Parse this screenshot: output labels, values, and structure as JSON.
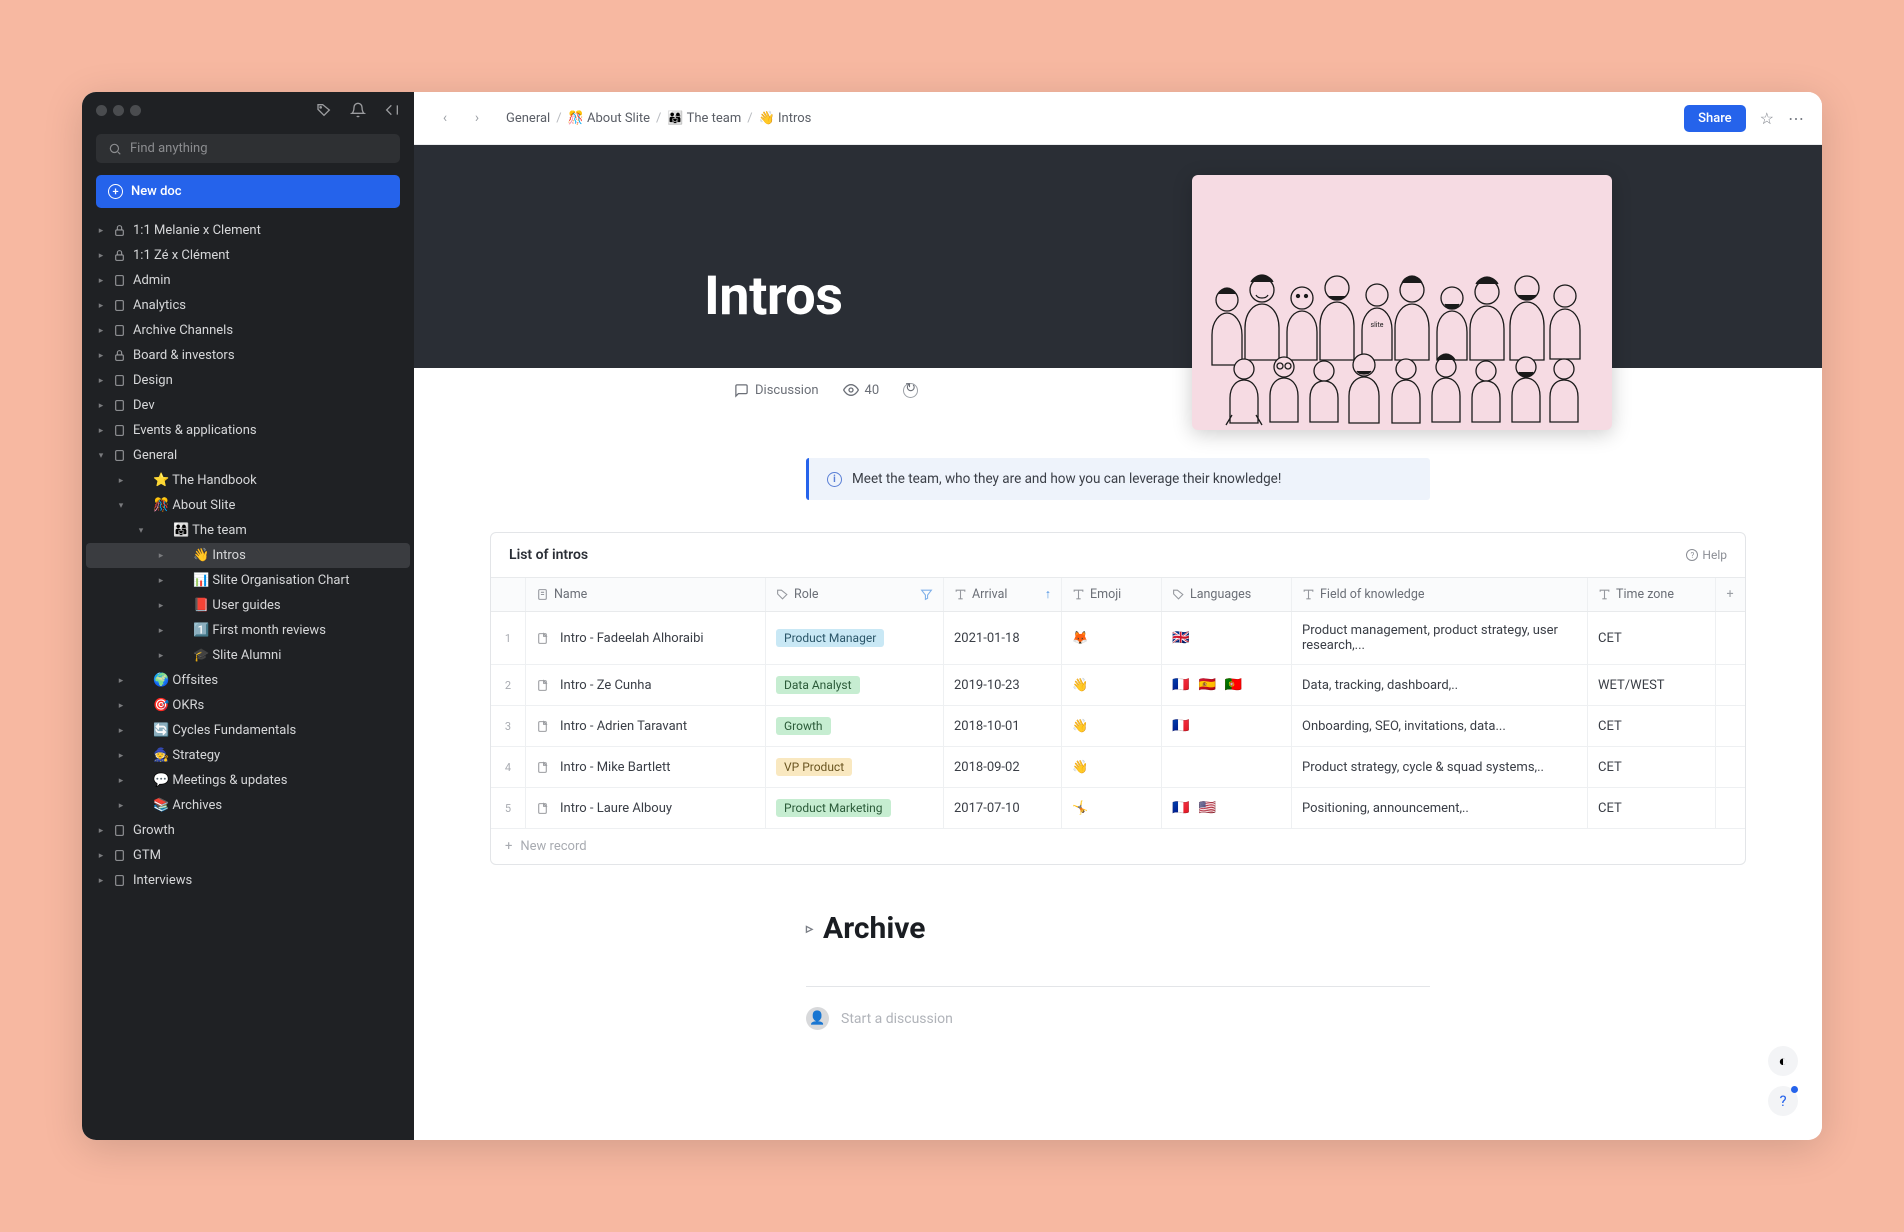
{
  "sidebar": {
    "search_placeholder": "Find anything",
    "new_doc": "New doc",
    "items": [
      {
        "label": "1:1 Melanie x Clement",
        "icon": "lock",
        "depth": 0,
        "tri": "▸"
      },
      {
        "label": "1:1 Zé x Clément",
        "icon": "lock",
        "depth": 0,
        "tri": "▸"
      },
      {
        "label": "Admin",
        "icon": "doc",
        "depth": 0,
        "tri": "▸"
      },
      {
        "label": "Analytics",
        "icon": "doc",
        "depth": 0,
        "tri": "▸"
      },
      {
        "label": "Archive Channels",
        "icon": "doc",
        "depth": 0,
        "tri": "▸"
      },
      {
        "label": "Board & investors",
        "icon": "lock",
        "depth": 0,
        "tri": "▸"
      },
      {
        "label": "Design",
        "icon": "doc",
        "depth": 0,
        "tri": "▸"
      },
      {
        "label": "Dev",
        "icon": "doc",
        "depth": 0,
        "tri": "▸"
      },
      {
        "label": "Events & applications",
        "icon": "doc",
        "depth": 0,
        "tri": "▸"
      },
      {
        "label": "General",
        "icon": "doc",
        "depth": 0,
        "tri": "▾"
      },
      {
        "label": "⭐ The Handbook",
        "icon": "",
        "depth": 1,
        "tri": "▸"
      },
      {
        "label": "🎊 About Slite",
        "icon": "",
        "depth": 1,
        "tri": "▾"
      },
      {
        "label": "👨‍👩‍👧 The team",
        "icon": "",
        "depth": 2,
        "tri": "▾"
      },
      {
        "label": "👋 Intros",
        "icon": "",
        "depth": 3,
        "tri": "▸",
        "active": true
      },
      {
        "label": "📊 Slite Organisation Chart",
        "icon": "",
        "depth": 3,
        "tri": "▸"
      },
      {
        "label": "📕 User guides",
        "icon": "",
        "depth": 3,
        "tri": "▸"
      },
      {
        "label": "1️⃣ First month reviews",
        "icon": "",
        "depth": 3,
        "tri": "▸"
      },
      {
        "label": "🎓 Slite Alumni",
        "icon": "",
        "depth": 3,
        "tri": "▸"
      },
      {
        "label": "🌍 Offsites",
        "icon": "",
        "depth": 1,
        "tri": "▸"
      },
      {
        "label": "🎯 OKRs",
        "icon": "",
        "depth": 1,
        "tri": "▸"
      },
      {
        "label": "🔄 Cycles Fundamentals",
        "icon": "",
        "depth": 1,
        "tri": "▸"
      },
      {
        "label": "🧙 Strategy",
        "icon": "",
        "depth": 1,
        "tri": "▸"
      },
      {
        "label": "💬 Meetings & updates",
        "icon": "",
        "depth": 1,
        "tri": "▸"
      },
      {
        "label": "📚 Archives",
        "icon": "",
        "depth": 1,
        "tri": "▸"
      },
      {
        "label": "Growth",
        "icon": "doc",
        "depth": 0,
        "tri": "▸"
      },
      {
        "label": "GTM",
        "icon": "doc",
        "depth": 0,
        "tri": "▸"
      },
      {
        "label": "Interviews",
        "icon": "doc",
        "depth": 0,
        "tri": "▸"
      }
    ]
  },
  "breadcrumb": [
    {
      "label": "General"
    },
    {
      "label": "🎊 About Slite"
    },
    {
      "label": "👨‍👩‍👧 The team"
    },
    {
      "label": "👋 Intros"
    }
  ],
  "share_label": "Share",
  "hero_title": "Intros",
  "discussion_label": "Discussion",
  "views_count": "40",
  "callout": "Meet the team, who they are and how you can leverage their knowledge!",
  "table": {
    "title": "List of intros",
    "help": "Help",
    "columns": [
      "Name",
      "Role",
      "Arrival",
      "Emoji",
      "Languages",
      "Field of knowledge",
      "Time zone"
    ],
    "rows": [
      {
        "idx": "1",
        "name": "Intro - Fadeelah Alhoraibi",
        "role": "Product Manager",
        "role_cls": "tag-pm",
        "arrival": "2021-01-18",
        "emoji": "🦊",
        "langs": [
          "🇬🇧"
        ],
        "know": "Product management, product strategy, user research,...",
        "tz": "CET"
      },
      {
        "idx": "2",
        "name": "Intro - Ze Cunha",
        "role": "Data Analyst",
        "role_cls": "tag-da",
        "arrival": "2019-10-23",
        "emoji": "👋",
        "langs": [
          "🇫🇷",
          "🇪🇸",
          "🇵🇹"
        ],
        "know": "Data, tracking, dashboard,..",
        "tz": "WET/WEST"
      },
      {
        "idx": "3",
        "name": "Intro - Adrien Taravant",
        "role": "Growth",
        "role_cls": "tag-gr",
        "arrival": "2018-10-01",
        "emoji": "👋",
        "langs": [
          "🇫🇷"
        ],
        "know": "Onboarding, SEO, invitations, data...",
        "tz": "CET"
      },
      {
        "idx": "4",
        "name": "Intro - Mike Bartlett",
        "role": "VP Product",
        "role_cls": "tag-vp",
        "arrival": "2018-09-02",
        "emoji": "👋",
        "langs": [],
        "know": "Product strategy, cycle & squad systems,..",
        "tz": "CET"
      },
      {
        "idx": "5",
        "name": "Intro - Laure Albouy",
        "role": "Product Marketing",
        "role_cls": "tag-mk",
        "arrival": "2017-07-10",
        "emoji": "🤸",
        "langs": [
          "🇫🇷",
          "🇺🇸"
        ],
        "know": "Positioning, announcement,..",
        "tz": "CET"
      }
    ],
    "new_record": "New record"
  },
  "archive_heading": "Archive",
  "discussion_prompt": "Start a discussion"
}
